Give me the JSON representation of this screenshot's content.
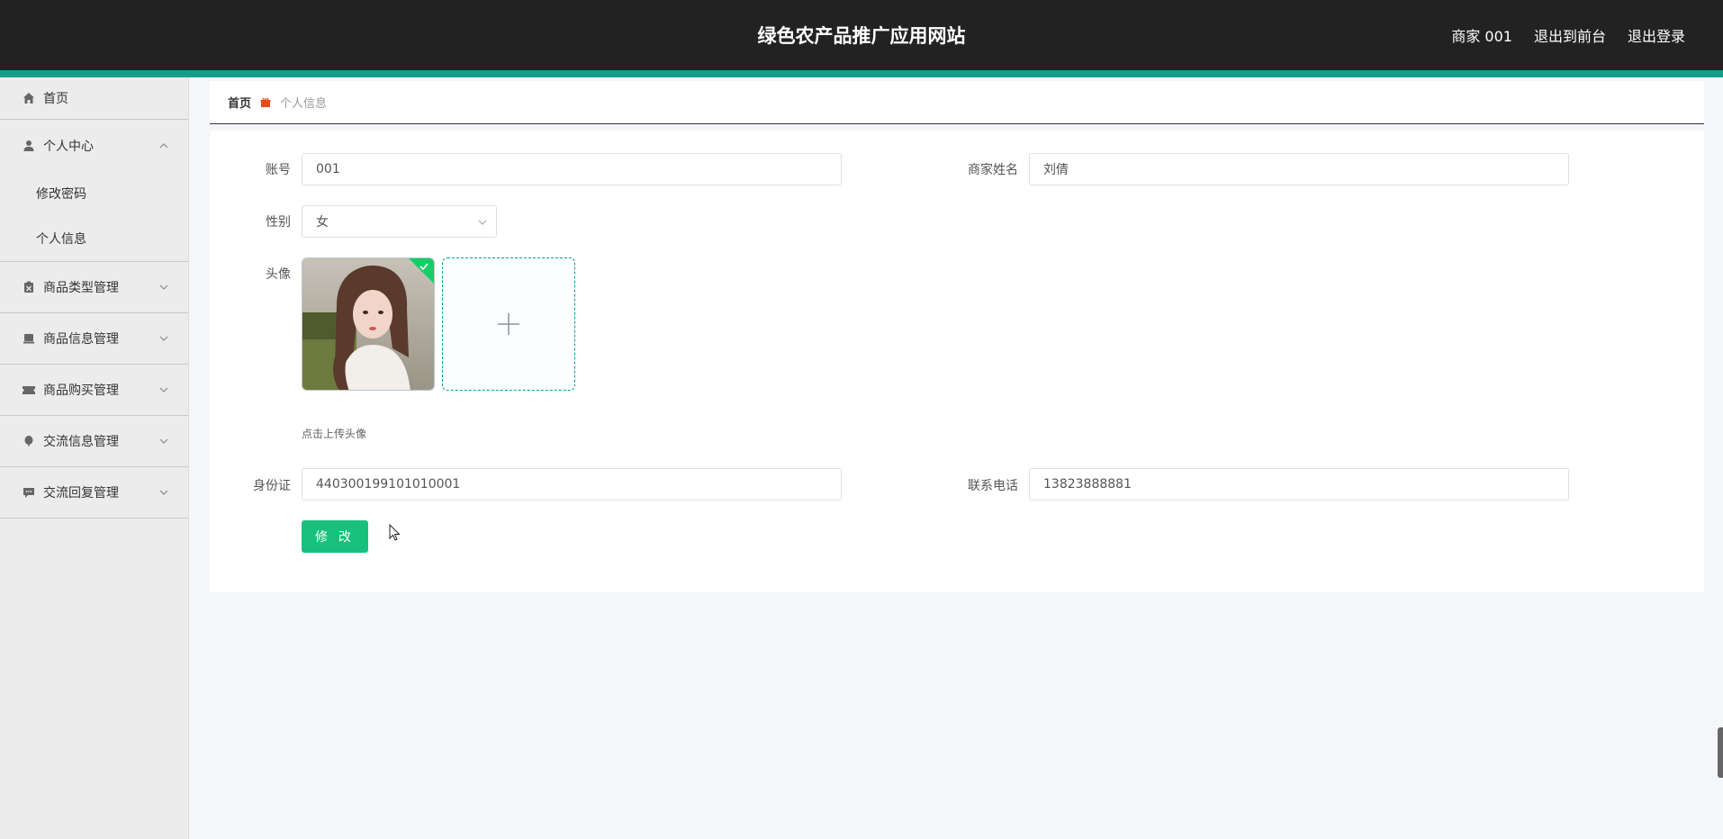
{
  "header": {
    "title": "绿色农产品推广应用网站",
    "links": [
      "商家 001",
      "退出到前台",
      "退出登录"
    ]
  },
  "sidebar": {
    "items": [
      {
        "label": "首页",
        "icon": "home-icon"
      },
      {
        "label": "个人中心",
        "icon": "user-icon",
        "expanded": true,
        "children": [
          "修改密码",
          "个人信息"
        ]
      },
      {
        "label": "商品类型管理",
        "icon": "clipboard-icon"
      },
      {
        "label": "商品信息管理",
        "icon": "box-icon"
      },
      {
        "label": "商品购买管理",
        "icon": "ticket-icon"
      },
      {
        "label": "交流信息管理",
        "icon": "balloon-icon"
      },
      {
        "label": "交流回复管理",
        "icon": "chat-icon"
      }
    ]
  },
  "breadcrumb": {
    "home": "首页",
    "current": "个人信息"
  },
  "form": {
    "account_label": "账号",
    "account_value": "001",
    "merchant_name_label": "商家姓名",
    "merchant_name_value": "刘倩",
    "gender_label": "性别",
    "gender_value": "女",
    "avatar_label": "头像",
    "avatar_tip": "点击上传头像",
    "id_label": "身份证",
    "id_value": "440300199101010001",
    "phone_label": "联系电话",
    "phone_value": "13823888881",
    "submit_label": "修 改"
  },
  "colors": {
    "header_bg": "#222222",
    "accent": "#10a08a",
    "button": "#19c07b",
    "breadcrumb_icon": "#e64a19"
  }
}
